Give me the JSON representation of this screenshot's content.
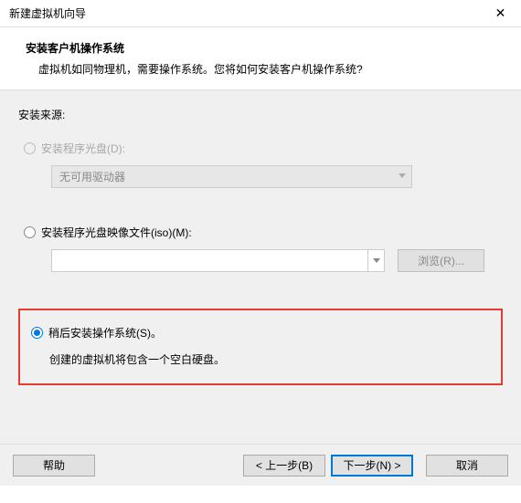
{
  "window": {
    "title": "新建虚拟机向导"
  },
  "header": {
    "title": "安装客户机操作系统",
    "subtitle": "虚拟机如同物理机，需要操作系统。您将如何安装客户机操作系统?"
  },
  "content": {
    "source_label": "安装来源:",
    "option_disc": {
      "label": "安装程序光盘(D):",
      "dropdown_value": "无可用驱动器"
    },
    "option_iso": {
      "label": "安装程序光盘映像文件(iso)(M):",
      "browse": "浏览(R)..."
    },
    "option_later": {
      "label": "稍后安装操作系统(S)。",
      "description": "创建的虚拟机将包含一个空白硬盘。"
    }
  },
  "footer": {
    "help": "帮助",
    "back": "< 上一步(B)",
    "next": "下一步(N) >",
    "cancel": "取消"
  }
}
